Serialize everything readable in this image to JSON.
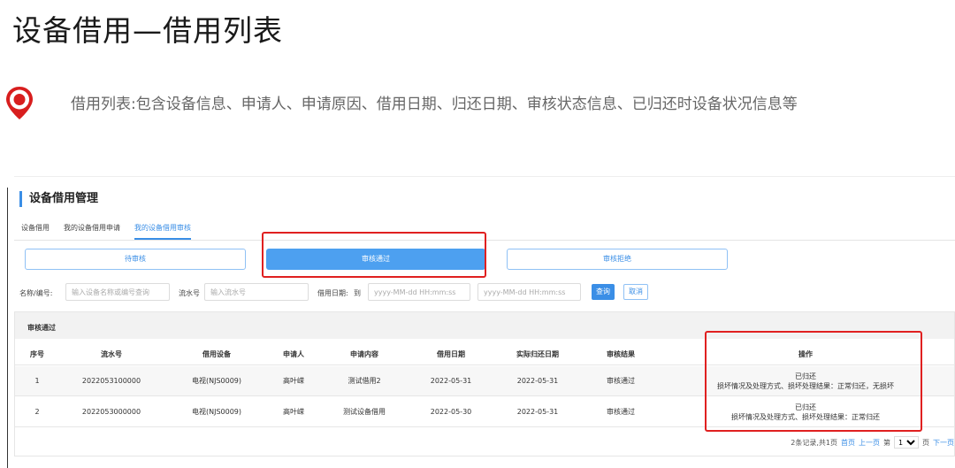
{
  "slide": {
    "title": "设备借用—借用列表",
    "description": "借用列表:包含设备信息、申请人、申请原因、借用日期、归还日期、审核状态信息、已归还时设备状况信息等",
    "accent_color": "#d81e1e"
  },
  "panel": {
    "title": "设备借用管理",
    "tabs": [
      "设备借用",
      "我的设备借用申请",
      "我的设备借用审核"
    ],
    "active_tab": 2,
    "status_buttons": [
      "待审核",
      "审核通过",
      "审核拒绝"
    ],
    "active_status": 1,
    "filter": {
      "name_label": "名称/编号:",
      "name_placeholder": "输入设备名称或编号查询",
      "serial_label": "流水号",
      "serial_placeholder": "输入流水号",
      "date_label": "借用日期:",
      "date_to": "到",
      "date_placeholder": "yyyy-MM-dd HH:mm:ss",
      "search_label": "查询",
      "cancel_label": "取消"
    },
    "table": {
      "header_title": "审核通过",
      "columns": [
        "序号",
        "流水号",
        "借用设备",
        "申请人",
        "申请内容",
        "借用日期",
        "实际归还日期",
        "审核结果",
        "操作"
      ],
      "rows": [
        {
          "no": "1",
          "serial": "2022053100000",
          "device": "电视(NJS0009)",
          "applicant": "高叶嵘",
          "content": "测试借用2",
          "borrow_date": "2022-05-31",
          "return_date": "2022-05-31",
          "result": "审核通过",
          "op_line1": "已归还",
          "op_line2": "损坏情况及处理方式、损坏处理结果：正常归还，无损坏"
        },
        {
          "no": "2",
          "serial": "2022053000000",
          "device": "电视(NJS0009)",
          "applicant": "高叶嵘",
          "content": "测试设备借用",
          "borrow_date": "2022-05-30",
          "return_date": "2022-05-31",
          "result": "审核通过",
          "op_line1": "已归还",
          "op_line2": "损坏情况及处理方式、损坏处理结果：正常归还"
        }
      ]
    },
    "pager": {
      "summary": "2条记录,共1页",
      "first": "首页",
      "prev": "上一页",
      "page_prefix": "第",
      "page_value": "1",
      "page_suffix": "页",
      "next": "下一页"
    }
  }
}
